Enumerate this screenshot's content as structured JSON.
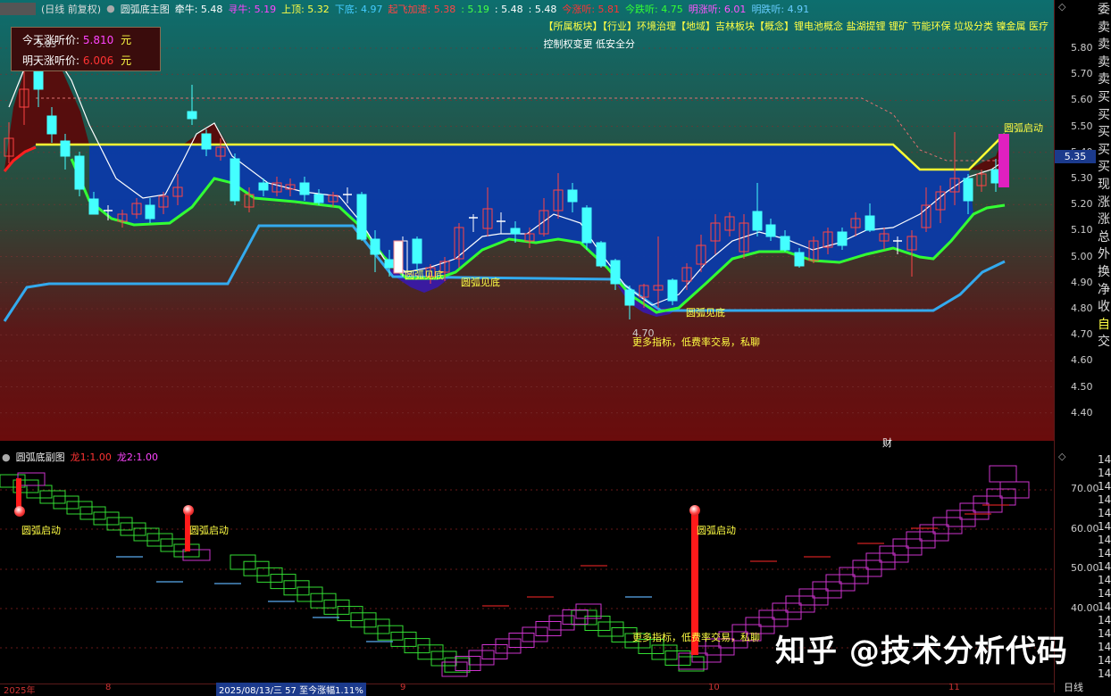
{
  "topbar": {
    "period": "(日线 前复权)",
    "indicator_main": "圆弧底主图",
    "items": [
      {
        "label": "牵牛:",
        "value": "5.48",
        "color": "#ffffff"
      },
      {
        "label": "寻牛:",
        "value": "5.19",
        "color": "#ff44ff"
      },
      {
        "label": "上顶:",
        "value": "5.32",
        "color": "#ffff44"
      },
      {
        "label": "下底:",
        "value": "4.97",
        "color": "#44ccff"
      },
      {
        "label": "起飞加速:",
        "value": "5.38",
        "color": "#ff4444"
      },
      {
        "label": ":",
        "value": "5.19",
        "color": "#44ff44"
      },
      {
        "label": ":",
        "value": "5.48",
        "color": "#ffffff"
      },
      {
        "label": ":",
        "value": "5.48",
        "color": "#ffffff"
      },
      {
        "label": "今涨听:",
        "value": "5.81",
        "color": "#ff3333"
      },
      {
        "label": "今跌听:",
        "value": "4.75",
        "color": "#33ff33"
      },
      {
        "label": "明涨听:",
        "value": "6.01",
        "color": "#ff55ff"
      },
      {
        "label": "明跌听:",
        "value": "4.91",
        "color": "#66ccff"
      }
    ]
  },
  "info_box": {
    "today_label": "今天涨听价:",
    "today_value": "5.810",
    "tomorrow_label": "明天涨听价:",
    "tomorrow_value": "6.006",
    "unit": "元",
    "price_high": "5.83"
  },
  "tags": {
    "line1": "【所属板块】【行业】环境治理【地域】吉林板块【概念】锂电池概念 盐湖提锂 锂矿 节能环保 垃圾分类 镍金属 医疗",
    "line2": "控制权变更 低安全分"
  },
  "main_labels": {
    "arc_start": "圆弧启动",
    "arc_bottom_1": "圆弧见底",
    "arc_bottom_2": "圆弧见底",
    "arc_bottom_3": "圆弧见底",
    "low_price": "4.70",
    "promo": "更多指标，低费率交易，私聊",
    "cai": "财"
  },
  "right_axis": {
    "price_labels": [
      "5.80",
      "5.70",
      "5.60",
      "5.50",
      "5.40",
      "5.30",
      "5.20",
      "5.10",
      "5.00",
      "4.90",
      "4.80",
      "4.70",
      "4.60",
      "4.50",
      "4.40"
    ],
    "current_price": "5.35",
    "sub_labels": [
      "70.00",
      "60.00",
      "50.00",
      "40.00"
    ],
    "side_chars": [
      "委",
      "卖",
      "卖",
      "卖",
      "卖",
      "买",
      "买",
      "买",
      "买",
      "买",
      "现",
      "涨",
      "涨",
      "总",
      "外",
      "换",
      "净",
      "收",
      "自",
      "交"
    ],
    "sub_side_chars": [
      "14",
      "14",
      "14",
      "14",
      "14",
      "14",
      "14",
      "14",
      "14",
      "14",
      "14",
      "14",
      "14",
      "14",
      "14",
      "14",
      "14"
    ],
    "bottom_label": "日线"
  },
  "sub_pane": {
    "title": "圆弧底副图",
    "long1_label": "龙1:",
    "long1_value": "1.00",
    "long2_label": "龙2:",
    "long2_value": "1.00",
    "signal_label": "圆弧启动",
    "promo": "更多指标，低费率交易，私聊"
  },
  "bottom_axis": {
    "year": "2025年",
    "m8": "8",
    "range": "2025/08/13/三 57 至今涨幅1.11%",
    "m9": "9",
    "m10": "10",
    "m11": "11"
  },
  "watermark": "知乎 @技术分析代码",
  "colors": {
    "yellow_line": "#ffff33",
    "green_line": "#33ff33",
    "blue_line": "#33aaee",
    "white_line": "#ffffff",
    "up_candle": "#ff4444",
    "down_candle": "#44ffff",
    "blue_fill": "#0b3aa8",
    "dark_red_fill": "#6a0e10"
  }
}
